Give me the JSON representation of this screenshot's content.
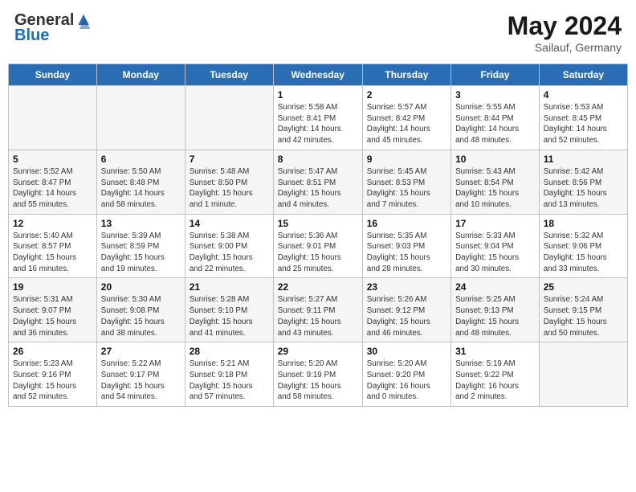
{
  "header": {
    "logo_general": "General",
    "logo_blue": "Blue",
    "month_title": "May 2024",
    "subtitle": "Sailauf, Germany"
  },
  "weekdays": [
    "Sunday",
    "Monday",
    "Tuesday",
    "Wednesday",
    "Thursday",
    "Friday",
    "Saturday"
  ],
  "weeks": [
    [
      {
        "day": "",
        "info": ""
      },
      {
        "day": "",
        "info": ""
      },
      {
        "day": "",
        "info": ""
      },
      {
        "day": "1",
        "info": "Sunrise: 5:58 AM\nSunset: 8:41 PM\nDaylight: 14 hours\nand 42 minutes."
      },
      {
        "day": "2",
        "info": "Sunrise: 5:57 AM\nSunset: 8:42 PM\nDaylight: 14 hours\nand 45 minutes."
      },
      {
        "day": "3",
        "info": "Sunrise: 5:55 AM\nSunset: 8:44 PM\nDaylight: 14 hours\nand 48 minutes."
      },
      {
        "day": "4",
        "info": "Sunrise: 5:53 AM\nSunset: 8:45 PM\nDaylight: 14 hours\nand 52 minutes."
      }
    ],
    [
      {
        "day": "5",
        "info": "Sunrise: 5:52 AM\nSunset: 8:47 PM\nDaylight: 14 hours\nand 55 minutes."
      },
      {
        "day": "6",
        "info": "Sunrise: 5:50 AM\nSunset: 8:48 PM\nDaylight: 14 hours\nand 58 minutes."
      },
      {
        "day": "7",
        "info": "Sunrise: 5:48 AM\nSunset: 8:50 PM\nDaylight: 15 hours\nand 1 minute."
      },
      {
        "day": "8",
        "info": "Sunrise: 5:47 AM\nSunset: 8:51 PM\nDaylight: 15 hours\nand 4 minutes."
      },
      {
        "day": "9",
        "info": "Sunrise: 5:45 AM\nSunset: 8:53 PM\nDaylight: 15 hours\nand 7 minutes."
      },
      {
        "day": "10",
        "info": "Sunrise: 5:43 AM\nSunset: 8:54 PM\nDaylight: 15 hours\nand 10 minutes."
      },
      {
        "day": "11",
        "info": "Sunrise: 5:42 AM\nSunset: 8:56 PM\nDaylight: 15 hours\nand 13 minutes."
      }
    ],
    [
      {
        "day": "12",
        "info": "Sunrise: 5:40 AM\nSunset: 8:57 PM\nDaylight: 15 hours\nand 16 minutes."
      },
      {
        "day": "13",
        "info": "Sunrise: 5:39 AM\nSunset: 8:59 PM\nDaylight: 15 hours\nand 19 minutes."
      },
      {
        "day": "14",
        "info": "Sunrise: 5:38 AM\nSunset: 9:00 PM\nDaylight: 15 hours\nand 22 minutes."
      },
      {
        "day": "15",
        "info": "Sunrise: 5:36 AM\nSunset: 9:01 PM\nDaylight: 15 hours\nand 25 minutes."
      },
      {
        "day": "16",
        "info": "Sunrise: 5:35 AM\nSunset: 9:03 PM\nDaylight: 15 hours\nand 28 minutes."
      },
      {
        "day": "17",
        "info": "Sunrise: 5:33 AM\nSunset: 9:04 PM\nDaylight: 15 hours\nand 30 minutes."
      },
      {
        "day": "18",
        "info": "Sunrise: 5:32 AM\nSunset: 9:06 PM\nDaylight: 15 hours\nand 33 minutes."
      }
    ],
    [
      {
        "day": "19",
        "info": "Sunrise: 5:31 AM\nSunset: 9:07 PM\nDaylight: 15 hours\nand 36 minutes."
      },
      {
        "day": "20",
        "info": "Sunrise: 5:30 AM\nSunset: 9:08 PM\nDaylight: 15 hours\nand 38 minutes."
      },
      {
        "day": "21",
        "info": "Sunrise: 5:28 AM\nSunset: 9:10 PM\nDaylight: 15 hours\nand 41 minutes."
      },
      {
        "day": "22",
        "info": "Sunrise: 5:27 AM\nSunset: 9:11 PM\nDaylight: 15 hours\nand 43 minutes."
      },
      {
        "day": "23",
        "info": "Sunrise: 5:26 AM\nSunset: 9:12 PM\nDaylight: 15 hours\nand 46 minutes."
      },
      {
        "day": "24",
        "info": "Sunrise: 5:25 AM\nSunset: 9:13 PM\nDaylight: 15 hours\nand 48 minutes."
      },
      {
        "day": "25",
        "info": "Sunrise: 5:24 AM\nSunset: 9:15 PM\nDaylight: 15 hours\nand 50 minutes."
      }
    ],
    [
      {
        "day": "26",
        "info": "Sunrise: 5:23 AM\nSunset: 9:16 PM\nDaylight: 15 hours\nand 52 minutes."
      },
      {
        "day": "27",
        "info": "Sunrise: 5:22 AM\nSunset: 9:17 PM\nDaylight: 15 hours\nand 54 minutes."
      },
      {
        "day": "28",
        "info": "Sunrise: 5:21 AM\nSunset: 9:18 PM\nDaylight: 15 hours\nand 57 minutes."
      },
      {
        "day": "29",
        "info": "Sunrise: 5:20 AM\nSunset: 9:19 PM\nDaylight: 15 hours\nand 58 minutes."
      },
      {
        "day": "30",
        "info": "Sunrise: 5:20 AM\nSunset: 9:20 PM\nDaylight: 16 hours\nand 0 minutes."
      },
      {
        "day": "31",
        "info": "Sunrise: 5:19 AM\nSunset: 9:22 PM\nDaylight: 16 hours\nand 2 minutes."
      },
      {
        "day": "",
        "info": ""
      }
    ]
  ]
}
